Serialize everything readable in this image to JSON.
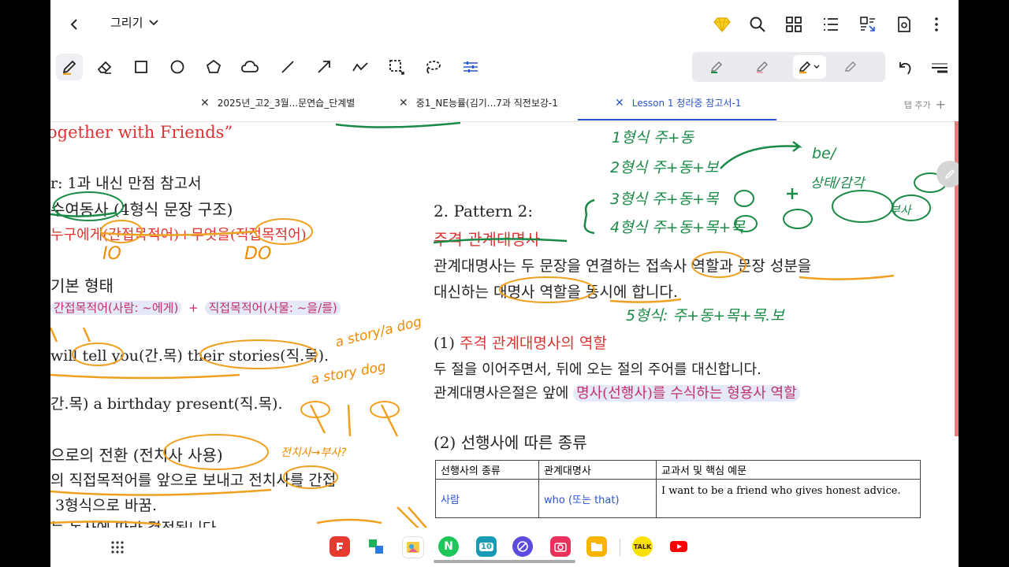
{
  "topbar": {
    "mode_label": "그리기",
    "icons": [
      "back-icon",
      "chevron-down-icon",
      "diamond-icon",
      "search-icon",
      "grid-icon",
      "list-icon",
      "convert-icon",
      "page-settings-icon",
      "more-icon"
    ]
  },
  "tabs": [
    {
      "label": "2025년_고2_3월...문연습_단계별",
      "active": false
    },
    {
      "label": "중1_NE능률(김기...7과 직전보강-1",
      "active": false
    },
    {
      "label": "Lesson 1 청라중 참고서-1",
      "active": true
    }
  ],
  "add_tab_label": "탭 추가",
  "colors": {
    "accent": "#2a55c9",
    "green_ink": "#1a8a47",
    "orange_ink": "#f0a020",
    "red_text": "#d33"
  },
  "doc": {
    "left": {
      "title": "ogether with Friends”",
      "line1": "r: 1과 내신 만점 참고서",
      "line2a": "수여동사",
      "line2b": "(4형식 문장 구조)",
      "line3": "누구에게(간접목적어)+무엇을(직접목적어)",
      "line4": "기본 형태",
      "pill1": "간접목적어(사람: ~에게)",
      "plus": "+",
      "pill2": "직접목적어(사물: ~을/를)",
      "ex1": "will tell you(간.목) their stories(직.목).",
      "ex2": "간.목) a birthday present(직.목).",
      "line5": "으로의 전환 (전치사 사용)",
      "line6": "의 직접목적어를 앞으로 보내고 전치사를 간접",
      "line7": "3형식으로 바꿈.",
      "line8": "는 동사에 따라 결정됩니다"
    },
    "right": {
      "heading": "2. Pattern 2:",
      "subheading": "주격 관계대명사",
      "para1": "관계대명사는 두 문장을 연결하는 접속사 역할과 문장 성분을",
      "para2": "대신하는 대명사 역할을 동시에 합니다.",
      "s1_num": "(1)",
      "s1_title": "주격 관계대명사의 역할",
      "s1_line1": "두 절을 이어주면서, 뒤에 오는 절의 주어를 대신합니다.",
      "s1_line2a": "관계대명사은절은 앞에",
      "s1_line2b": "명사(선행사)를 수식하는 형용사 역할",
      "s2_title": "(2) 선행사에 따른 종류",
      "table": {
        "headers": [
          "선행사의 종류",
          "관계대명사",
          "교과서 및 핵심 예문"
        ],
        "rows": [
          [
            "사람",
            "who (또는 that)",
            "I want to be a friend who gives honest advice."
          ]
        ]
      }
    },
    "handwriting": {
      "h1": "1형식 주+동",
      "h2": "2형식 주+동+보",
      "h3": "3형식 주+동+목",
      "h4": "4형식 주+동+목+목",
      "h5": "5형식: 주+동+목+목.보",
      "be": "be/",
      "sense": "상태/감각",
      "adv": "부사",
      "n10": "IO",
      "ndo": "DO",
      "story": "a story/a dog",
      "story2": "a story dog",
      "prep": "전치사→부사?"
    }
  },
  "taskbar": {
    "apps": [
      "Flexcil",
      "Papago",
      "Gallery",
      "Naver",
      "Calendar",
      "Internet",
      "Camera",
      "Files",
      "KakaoTalk",
      "YouTube"
    ],
    "kakao_label": "TALK",
    "cal_label": "10",
    "naver_label": "N"
  }
}
